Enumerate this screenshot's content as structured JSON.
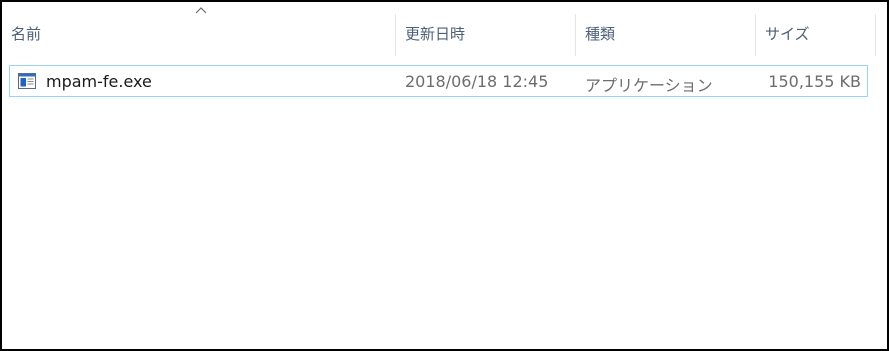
{
  "columns": {
    "name": "名前",
    "date_modified": "更新日時",
    "type": "種類",
    "size": "サイズ"
  },
  "sort": {
    "column": "name",
    "icon": "sort-ascending-caret-icon"
  },
  "files": [
    {
      "name": "mpam-fe.exe",
      "date_modified": "2018/06/18 12:45",
      "type": "アプリケーション",
      "size": "150,155 KB",
      "icon": "application-exe-icon"
    }
  ],
  "colors": {
    "header_text": "#4c607a",
    "row_border": "#99d1ff",
    "detail_text": "#6d6d6d",
    "window_border": "#000000"
  }
}
